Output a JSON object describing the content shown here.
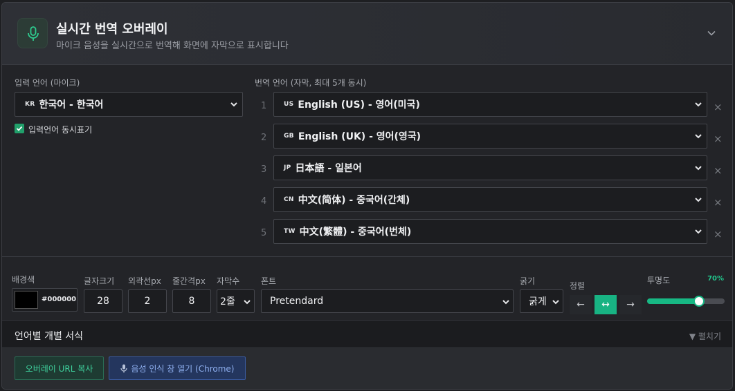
{
  "header": {
    "title": "실시간 번역 오버레이",
    "subtitle": "마이크 음성을 실시간으로 번역해 화면에 자막으로 표시합니다"
  },
  "input": {
    "label": "입력 언어 (마이크)",
    "selected_code": "KR",
    "selected_label": "한국어 - 한국어",
    "show_input_label": "입력언어 동시표기",
    "show_input_checked": true
  },
  "translation": {
    "label": "번역 언어 (자막, 최대 5개 동시)",
    "rows": [
      {
        "num": "1",
        "code": "US",
        "label": "English (US) - 영어(미국)"
      },
      {
        "num": "2",
        "code": "GB",
        "label": "English (UK) - 영어(영국)"
      },
      {
        "num": "3",
        "code": "JP",
        "label": "日本語 - 일본어"
      },
      {
        "num": "4",
        "code": "CN",
        "label": "中文(简体) - 중국어(간체)"
      },
      {
        "num": "5",
        "code": "TW",
        "label": "中文(繁體) - 중국어(번체)"
      }
    ],
    "remove_symbol": "×"
  },
  "style": {
    "bg_label": "배경색",
    "bg_color": "#000000",
    "font_size_label": "글자크기",
    "font_size": "28",
    "outline_label": "외곽선px",
    "outline": "2",
    "line_gap_label": "줄간격px",
    "line_gap": "8",
    "lines_label": "자막수",
    "lines": "2줄",
    "font_label": "폰트",
    "font": "Pretendard",
    "weight_label": "굵기",
    "weight": "굵게",
    "align_label": "정렬",
    "align_left": "←",
    "align_center": "↔",
    "align_right": "→",
    "align_selected": "center",
    "opacity_label": "투명도",
    "opacity_text": "70%",
    "opacity_value": 0.7
  },
  "per_language": {
    "title": "언어별 개별 서식",
    "expand_label": "▼ 펼치기"
  },
  "footer": {
    "copy_url": "오버레이 URL 복사",
    "open_recognition": "음성 인식 창 열기 (Chrome)"
  },
  "colors": {
    "accent": "#17b884",
    "button_blue": "#24365e"
  }
}
